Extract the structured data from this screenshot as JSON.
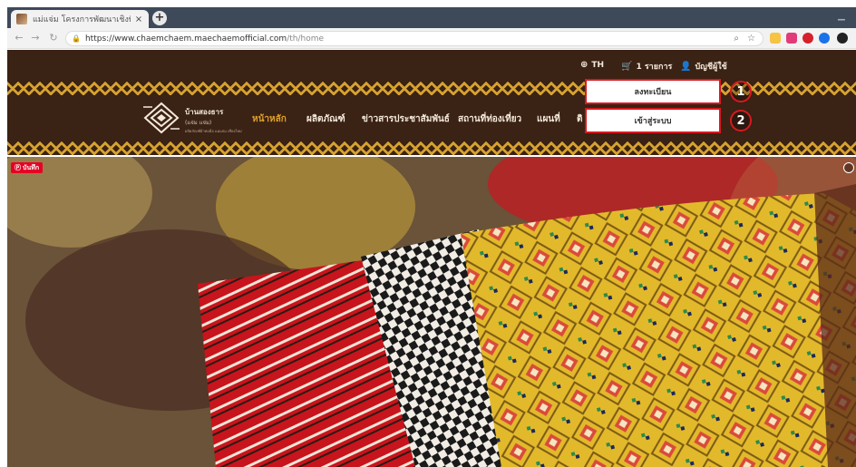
{
  "browser": {
    "tab_title": "แม่แจ่ม โครงการพัฒนาเชิงพื้นที่แม่แจ่ม",
    "tab_close": "×",
    "new_tab": "+",
    "url_domain": "https://www.chaemchaem.maechaemofficial.com",
    "url_path": "/th/home"
  },
  "site": {
    "language": "TH",
    "cart_label": "1 รายการ",
    "account_label": "บัญชีผู้ใช้",
    "brand": {
      "name": "บ้านสองธาร",
      "sub": "(แจ่ม แจ่ม)",
      "tiny": "ผลิตภัณฑ์ผ้าทอมือ แม่แจ่ม เชียงใหม่"
    },
    "nav": [
      {
        "label": "หน้าหลัก",
        "active": true
      },
      {
        "label": "ผลิตภัณฑ์",
        "active": false
      },
      {
        "label": "ข่าวสารประชาสัมพันธ์",
        "active": false
      },
      {
        "label": "สถานที่ท่องเที่ยว",
        "active": false
      },
      {
        "label": "แผนที่",
        "active": false
      },
      {
        "label": "ติ",
        "active": false
      }
    ],
    "dropdown": [
      {
        "label": "ลงทะเบียน",
        "step": "1"
      },
      {
        "label": "เข้าสู่ระบบ",
        "step": "2"
      }
    ],
    "pin_badge": "บันทึก"
  },
  "colors": {
    "header_bg": "#3a2214",
    "accent": "#e0a12b",
    "highlight": "#d71920"
  }
}
